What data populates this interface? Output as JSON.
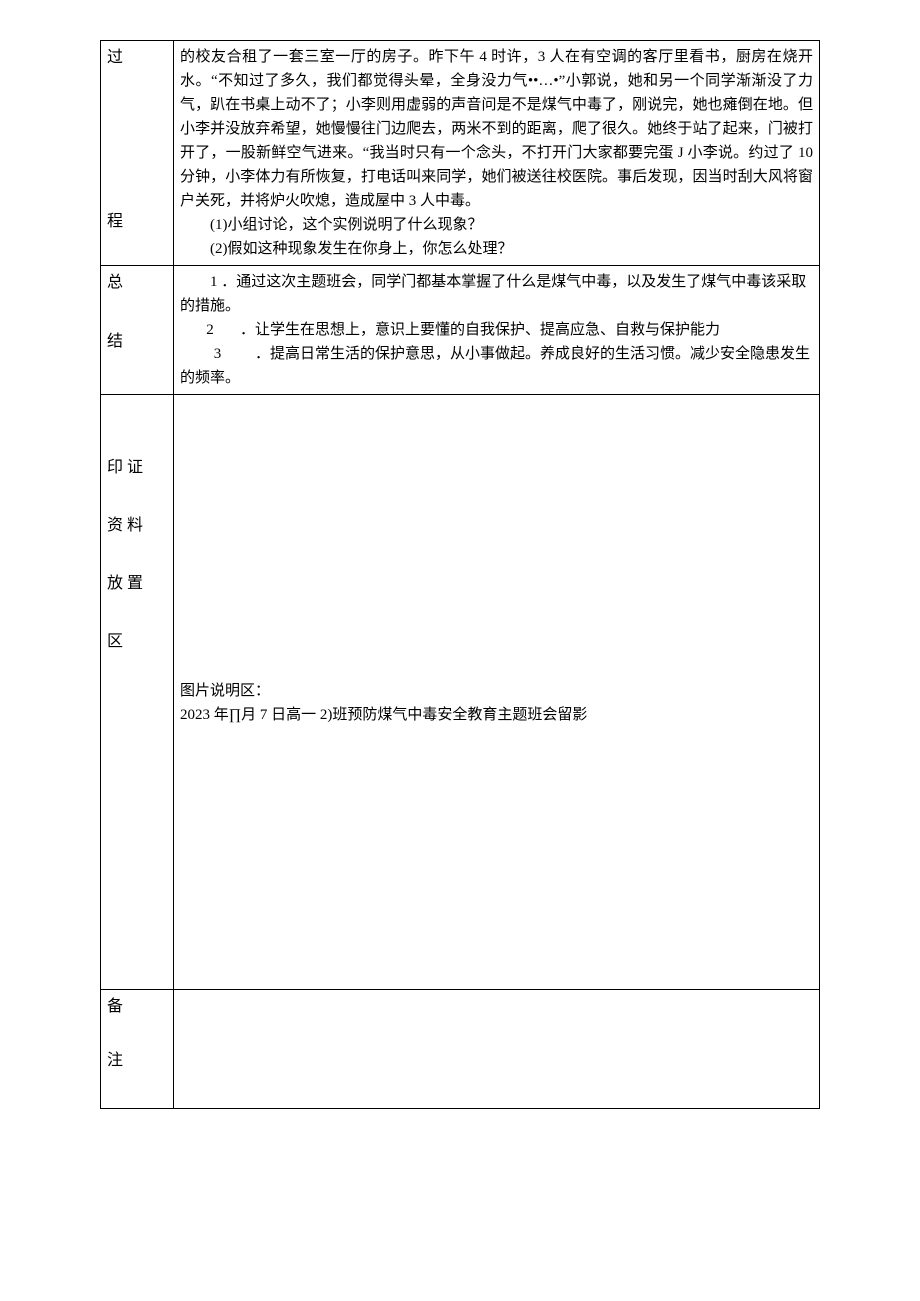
{
  "row1": {
    "label_a": "过",
    "label_b": "程",
    "story": "的校友合租了一套三室一厅的房子。昨下午 4 时许，3 人在有空调的客厅里看书，厨房在烧开水。“不知过了多久，我们都觉得头晕，全身没力气••…•”小郭说，她和另一个同学渐渐没了力气，趴在书桌上动不了；小李则用虚弱的声音问是不是煤气中毒了，刚说完，她也瘫倒在地。但小李并没放弃希望，她慢慢往门边爬去，两米不到的距离，爬了很久。她终于站了起来，门被打开了，一股新鲜空气进来。“我当时只有一个念头，不打开门大家都要完蛋 J 小李说。约过了 10 分钟，小李体力有所恢复，打电话叫来同学，她们被送往校医院。事后发现，因当时刮大风将窗户关死，并将炉火吹熄，造成屋中 3 人中毒。",
    "q1": "(1)小组讨论，这个实例说明了什么现象？",
    "q2": "(2)假如这种现象发生在你身上，你怎么处理？"
  },
  "row2": {
    "label_a": "总",
    "label_b": "结",
    "item1": "1 ．通过这次主题班会，同学门都基本掌握了什么是煤气中毒，以及发生了煤气中毒该采取的措施。",
    "item2_num": "2",
    "item2_text": "．让学生在思想上，意识上要懂的自我保护、提高应急、自救与保护能力",
    "item3_num": "3",
    "item3_text": "．提高日常生活的保护意思，从小事做起。养成良好的生活习惯。减少安全隐患发生的频率。"
  },
  "row3": {
    "label_a": "印  证",
    "label_b": "资  料",
    "label_c": "放  置",
    "label_d": "区",
    "caption_label": "图片说明区：",
    "caption_text": "2023 年∏月 7 日高一 2)班预防煤气中毒安全教育主题班会留影"
  },
  "row4": {
    "label_a": "备",
    "label_b": "注"
  }
}
